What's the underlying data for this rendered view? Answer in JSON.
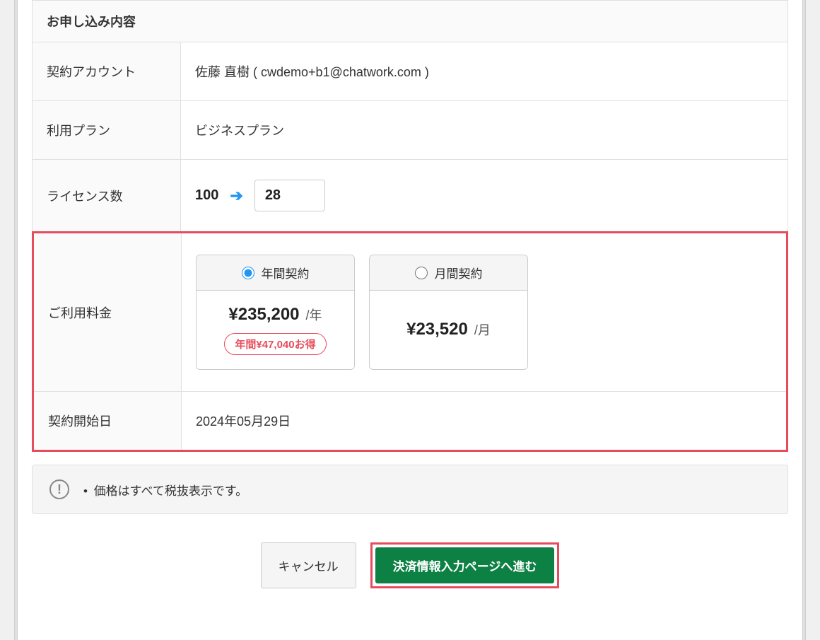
{
  "section_header": "お申し込み内容",
  "rows": {
    "account": {
      "label": "契約アカウント",
      "value": "佐藤 直樹 ( cwdemo+b1@chatwork.com )"
    },
    "plan": {
      "label": "利用プラン",
      "value": "ビジネスプラン"
    },
    "license": {
      "label": "ライセンス数",
      "current": "100",
      "new_value": "28"
    },
    "pricing": {
      "label": "ご利用料金",
      "annual": {
        "title": "年間契約",
        "price": "¥235,200",
        "period": "/年",
        "savings": "年間¥47,040お得"
      },
      "monthly": {
        "title": "月間契約",
        "price": "¥23,520",
        "period": "/月"
      }
    },
    "start_date": {
      "label": "契約開始日",
      "value": "2024年05月29日"
    }
  },
  "notice": "価格はすべて税抜表示です。",
  "buttons": {
    "cancel": "キャンセル",
    "proceed": "決済情報入力ページへ進む"
  }
}
